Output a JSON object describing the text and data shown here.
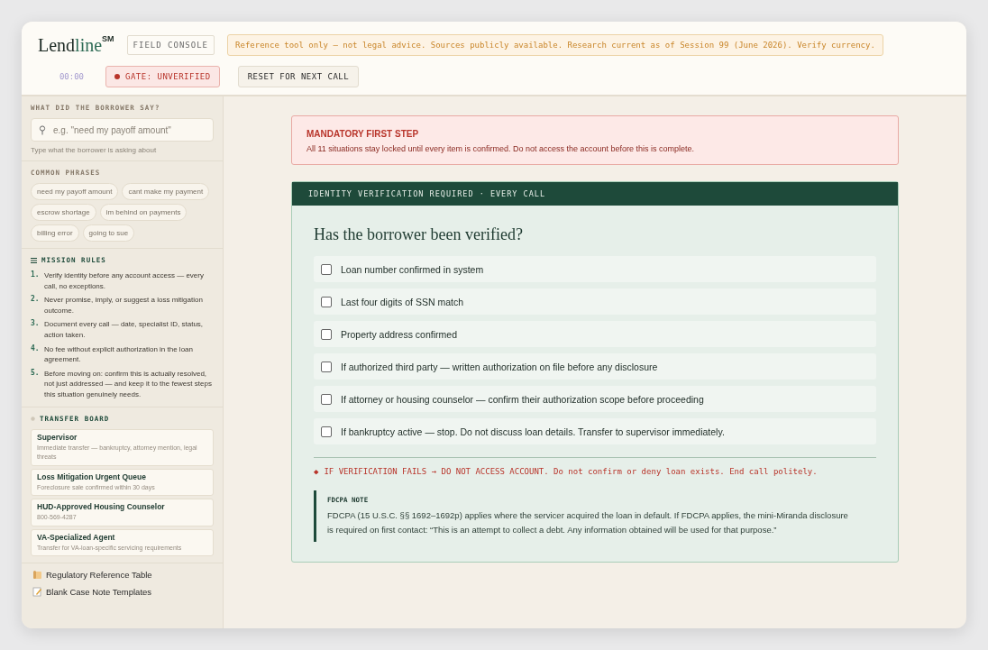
{
  "brand": {
    "text": "Lend",
    "accent": "line",
    "superscript": "SM"
  },
  "header": {
    "badge": "FIELD CONSOLE",
    "notice": "Reference tool only — not legal advice. Sources publicly available. Research current as of Session 99 (June 2026). Verify currency.",
    "timer": "00:00",
    "gate": {
      "label": "GATE: UNVERIFIED",
      "verified": false
    },
    "reset_button": "RESET FOR NEXT CALL"
  },
  "sidebar": {
    "search": {
      "heading": "WHAT DID THE BORROWER SAY?",
      "placeholder": "e.g. \"need my payoff amount\"",
      "hint": "Type what the borrower is asking about"
    },
    "phrases": {
      "heading": "COMMON PHRASES",
      "items": [
        "need my payoff amount",
        "cant make my payment",
        "escrow shortage",
        "im behind on payments",
        "billing error",
        "going to sue"
      ]
    },
    "rules": {
      "heading": "MISSION RULES",
      "items": [
        {
          "number": "1.",
          "text": "Verify identity before any account access — every call, no exceptions."
        },
        {
          "number": "2.",
          "text": "Never promise, imply, or suggest a loss mitigation outcome."
        },
        {
          "number": "3.",
          "text": "Document every call — date, specialist ID, status, action taken."
        },
        {
          "number": "4.",
          "text": "No fee without explicit authorization in the loan agreement."
        },
        {
          "number": "5.",
          "text": "Before moving on: confirm this is actually resolved, not just addressed — and keep it to the fewest steps this situation genuinely needs."
        }
      ]
    },
    "transfer_board": {
      "heading": "TRANSFER BOARD",
      "items": [
        {
          "title": "Supervisor",
          "detail": "Immediate transfer — bankruptcy, attorney mention, legal threats"
        },
        {
          "title": "Loss Mitigation Urgent Queue",
          "detail": "Foreclosure sale confirmed within 30 days"
        },
        {
          "title": "HUD-Approved Housing Counselor",
          "detail": "800-569-4287"
        },
        {
          "title": "VA-Specialized Agent",
          "detail": "Transfer for VA-loan-specific servicing requirements"
        }
      ]
    },
    "links": [
      {
        "label": "Regulatory Reference Table",
        "kind": "scroll"
      },
      {
        "label": "Blank Case Note Templates",
        "kind": "memo"
      }
    ]
  },
  "alert": {
    "title": "MANDATORY FIRST STEP",
    "text": "All 11 situations stay locked until every item is confirmed. Do not access the account before this is complete."
  },
  "verification": {
    "banner": "IDENTITY VERIFICATION REQUIRED · EVERY CALL",
    "question": "Has the borrower been verified?",
    "items": [
      {
        "label": "Loan number confirmed in system",
        "checked": false
      },
      {
        "label": "Last four digits of SSN match",
        "checked": false
      },
      {
        "label": "Property address confirmed",
        "checked": false
      },
      {
        "label": "If authorized third party — written authorization on file before any disclosure",
        "checked": false
      },
      {
        "label": "If attorney or housing counselor — confirm their authorization scope before proceeding",
        "checked": false
      },
      {
        "label": "If bankruptcy active — stop. Do not discuss loan details. Transfer to supervisor immediately.",
        "checked": false
      }
    ],
    "warning_icon": "◆",
    "warning": "IF VERIFICATION FAILS → DO NOT ACCESS ACCOUNT. Do not confirm or deny loan exists. End call politely.",
    "note": {
      "title": "FDCPA NOTE",
      "text": "FDCPA (15 U.S.C. §§ 1692–1692p) applies where the servicer acquired the loan in default. If FDCPA applies, the mini-Miranda disclosure is required on first contact: “This is an attempt to collect a debt. Any information obtained will be used for that purpose.”"
    }
  }
}
